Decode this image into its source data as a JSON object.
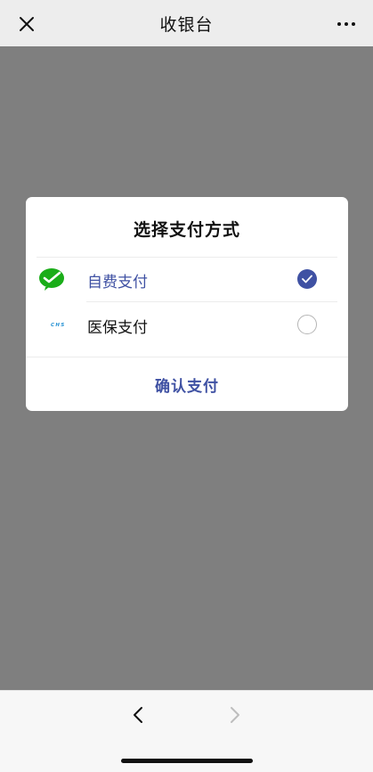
{
  "navbar": {
    "title": "收银台",
    "close_icon": "close-icon",
    "more_icon": "more-icon"
  },
  "dialog": {
    "title": "选择支付方式",
    "options": [
      {
        "label": "自费支付",
        "icon": "wechat-pay-icon",
        "selected": true
      },
      {
        "label": "医保支付",
        "icon": "chs-medical-insurance-icon",
        "logo_text": "CHS",
        "selected": false
      }
    ],
    "confirm_label": "确认支付"
  },
  "bottom_bar": {
    "back_icon": "chevron-left-icon",
    "forward_icon": "chevron-right-icon"
  },
  "colors": {
    "accent": "#3f51a3",
    "wechat_green": "#1aad19",
    "chs_blue": "#1f8ed2",
    "overlay": "#7f7f7f"
  }
}
